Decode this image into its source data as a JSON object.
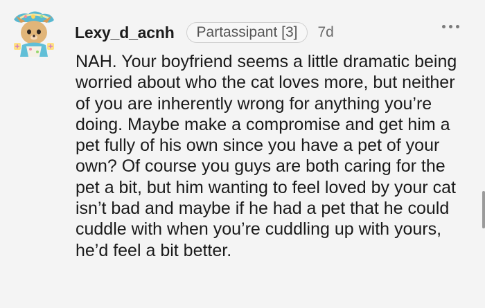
{
  "comment": {
    "username": "Lexy_d_acnh",
    "flair": "Partassipant [3]",
    "timestamp": "7d",
    "more_icon": "more-horizontal-icon",
    "body": "NAH. Your boyfriend seems a little dramatic being worried about who the cat loves more, but neither of you are inherently wrong for anything you’re doing. Maybe make a compromise and get him a pet fully of his own since you have a pet of your own? Of course you guys are both caring for the pet a bit, but him wanting to feel loved by your cat isn’t bad and maybe if he had a pet that he could cuddle with when you’re cuddling up with yours, he’d feel a bit better."
  },
  "colors": {
    "background": "#f4f4f4",
    "text": "#1a1a1a",
    "muted": "#6a6a6a",
    "flair_border": "#cfcfcf"
  }
}
